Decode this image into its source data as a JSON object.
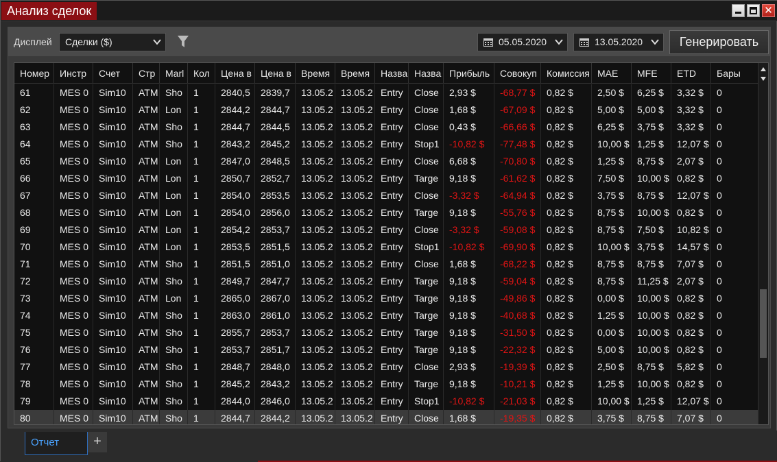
{
  "window": {
    "title": "Анализ сделок"
  },
  "toolbar": {
    "display_label": "Дисплей",
    "display_value": "Сделки ($)",
    "date_from": "05.05.2020",
    "date_to": "13.05.2020",
    "generate_label": "Генерировать"
  },
  "table": {
    "columns": [
      "Номер",
      "Инстр",
      "Счет",
      "Стр",
      "Marl",
      "Кол",
      "Цена в",
      "Цена в",
      "Время",
      "Время",
      "Назва",
      "Назва",
      "Прибыль",
      "Совокуп",
      "Комиссия",
      "MAE",
      "MFE",
      "ETD",
      "Бары"
    ],
    "rows": [
      [
        "61",
        "MES 0",
        "Sim10",
        "ATM",
        "Sho",
        "1",
        "2840,5",
        "2839,7",
        "13.05.2",
        "13.05.2",
        "Entry",
        "Close",
        "2,93 $",
        "-68,77 $",
        "0,82 $",
        "2,50 $",
        "6,25 $",
        "3,32 $",
        "0"
      ],
      [
        "62",
        "MES 0",
        "Sim10",
        "ATM",
        "Lon",
        "1",
        "2844,2",
        "2844,7",
        "13.05.2",
        "13.05.2",
        "Entry",
        "Close",
        "1,68 $",
        "-67,09 $",
        "0,82 $",
        "5,00 $",
        "5,00 $",
        "3,32 $",
        "0"
      ],
      [
        "63",
        "MES 0",
        "Sim10",
        "ATM",
        "Sho",
        "1",
        "2844,7",
        "2844,5",
        "13.05.2",
        "13.05.2",
        "Entry",
        "Close",
        "0,43 $",
        "-66,66 $",
        "0,82 $",
        "6,25 $",
        "3,75 $",
        "3,32 $",
        "0"
      ],
      [
        "64",
        "MES 0",
        "Sim10",
        "ATM",
        "Sho",
        "1",
        "2843,2",
        "2845,2",
        "13.05.2",
        "13.05.2",
        "Entry",
        "Stop1",
        "-10,82 $",
        "-77,48 $",
        "0,82 $",
        "10,00 $",
        "1,25 $",
        "12,07 $",
        "0"
      ],
      [
        "65",
        "MES 0",
        "Sim10",
        "ATM",
        "Lon",
        "1",
        "2847,0",
        "2848,5",
        "13.05.2",
        "13.05.2",
        "Entry",
        "Close",
        "6,68 $",
        "-70,80 $",
        "0,82 $",
        "1,25 $",
        "8,75 $",
        "2,07 $",
        "0"
      ],
      [
        "66",
        "MES 0",
        "Sim10",
        "ATM",
        "Lon",
        "1",
        "2850,7",
        "2852,7",
        "13.05.2",
        "13.05.2",
        "Entry",
        "Targe",
        "9,18 $",
        "-61,62 $",
        "0,82 $",
        "7,50 $",
        "10,00 $",
        "0,82 $",
        "0"
      ],
      [
        "67",
        "MES 0",
        "Sim10",
        "ATM",
        "Lon",
        "1",
        "2854,0",
        "2853,5",
        "13.05.2",
        "13.05.2",
        "Entry",
        "Close",
        "-3,32 $",
        "-64,94 $",
        "0,82 $",
        "3,75 $",
        "8,75 $",
        "12,07 $",
        "0"
      ],
      [
        "68",
        "MES 0",
        "Sim10",
        "ATM",
        "Lon",
        "1",
        "2854,0",
        "2856,0",
        "13.05.2",
        "13.05.2",
        "Entry",
        "Targe",
        "9,18 $",
        "-55,76 $",
        "0,82 $",
        "8,75 $",
        "10,00 $",
        "0,82 $",
        "0"
      ],
      [
        "69",
        "MES 0",
        "Sim10",
        "ATM",
        "Lon",
        "1",
        "2854,2",
        "2853,7",
        "13.05.2",
        "13.05.2",
        "Entry",
        "Close",
        "-3,32 $",
        "-59,08 $",
        "0,82 $",
        "8,75 $",
        "7,50 $",
        "10,82 $",
        "0"
      ],
      [
        "70",
        "MES 0",
        "Sim10",
        "ATM",
        "Lon",
        "1",
        "2853,5",
        "2851,5",
        "13.05.2",
        "13.05.2",
        "Entry",
        "Stop1",
        "-10,82 $",
        "-69,90 $",
        "0,82 $",
        "10,00 $",
        "3,75 $",
        "14,57 $",
        "0"
      ],
      [
        "71",
        "MES 0",
        "Sim10",
        "ATM",
        "Sho",
        "1",
        "2851,5",
        "2851,0",
        "13.05.2",
        "13.05.2",
        "Entry",
        "Close",
        "1,68 $",
        "-68,22 $",
        "0,82 $",
        "8,75 $",
        "8,75 $",
        "7,07 $",
        "0"
      ],
      [
        "72",
        "MES 0",
        "Sim10",
        "ATM",
        "Sho",
        "1",
        "2849,7",
        "2847,7",
        "13.05.2",
        "13.05.2",
        "Entry",
        "Targe",
        "9,18 $",
        "-59,04 $",
        "0,82 $",
        "8,75 $",
        "11,25 $",
        "2,07 $",
        "0"
      ],
      [
        "73",
        "MES 0",
        "Sim10",
        "ATM",
        "Lon",
        "1",
        "2865,0",
        "2867,0",
        "13.05.2",
        "13.05.2",
        "Entry",
        "Targe",
        "9,18 $",
        "-49,86 $",
        "0,82 $",
        "0,00 $",
        "10,00 $",
        "0,82 $",
        "0"
      ],
      [
        "74",
        "MES 0",
        "Sim10",
        "ATM",
        "Sho",
        "1",
        "2863,0",
        "2861,0",
        "13.05.2",
        "13.05.2",
        "Entry",
        "Targe",
        "9,18 $",
        "-40,68 $",
        "0,82 $",
        "1,25 $",
        "10,00 $",
        "0,82 $",
        "0"
      ],
      [
        "75",
        "MES 0",
        "Sim10",
        "ATM",
        "Sho",
        "1",
        "2855,7",
        "2853,7",
        "13.05.2",
        "13.05.2",
        "Entry",
        "Targe",
        "9,18 $",
        "-31,50 $",
        "0,82 $",
        "0,00 $",
        "10,00 $",
        "0,82 $",
        "0"
      ],
      [
        "76",
        "MES 0",
        "Sim10",
        "ATM",
        "Sho",
        "1",
        "2853,7",
        "2851,7",
        "13.05.2",
        "13.05.2",
        "Entry",
        "Targe",
        "9,18 $",
        "-22,32 $",
        "0,82 $",
        "5,00 $",
        "10,00 $",
        "0,82 $",
        "0"
      ],
      [
        "77",
        "MES 0",
        "Sim10",
        "ATM",
        "Sho",
        "1",
        "2848,7",
        "2848,0",
        "13.05.2",
        "13.05.2",
        "Entry",
        "Close",
        "2,93 $",
        "-19,39 $",
        "0,82 $",
        "2,50 $",
        "8,75 $",
        "5,82 $",
        "0"
      ],
      [
        "78",
        "MES 0",
        "Sim10",
        "ATM",
        "Sho",
        "1",
        "2845,2",
        "2843,2",
        "13.05.2",
        "13.05.2",
        "Entry",
        "Targe",
        "9,18 $",
        "-10,21 $",
        "0,82 $",
        "1,25 $",
        "10,00 $",
        "0,82 $",
        "0"
      ],
      [
        "79",
        "MES 0",
        "Sim10",
        "ATM",
        "Sho",
        "1",
        "2844,0",
        "2846,0",
        "13.05.2",
        "13.05.2",
        "Entry",
        "Stop1",
        "-10,82 $",
        "-21,03 $",
        "0,82 $",
        "10,00 $",
        "1,25 $",
        "12,07 $",
        "0"
      ],
      [
        "80",
        "MES 0",
        "Sim10",
        "ATM",
        "Sho",
        "1",
        "2844,7",
        "2844,2",
        "13.05.2",
        "13.05.2",
        "Entry",
        "Close",
        "1,68 $",
        "-19,35 $",
        "0,82 $",
        "3,75 $",
        "8,75 $",
        "7,07 $",
        "0"
      ]
    ],
    "selected_row": "80"
  },
  "tabs": {
    "active_label": "Отчет",
    "add_label": "+"
  },
  "colors": {
    "title_bg": "#8b0f14",
    "negative": "#e01414",
    "tab_accent": "#4aa3ff"
  }
}
